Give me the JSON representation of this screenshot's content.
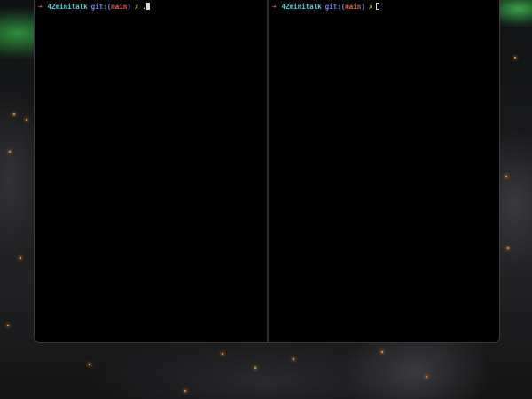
{
  "terminal": {
    "panes": [
      {
        "prompt_arrow": "➜",
        "directory": "42minitalk",
        "git_label": "git:",
        "paren_open": "(",
        "branch": "main",
        "paren_close": ")",
        "dirty_marker": "✗",
        "typed_text": "."
      },
      {
        "prompt_arrow": "➜",
        "directory": "42minitalk",
        "git_label": "git:",
        "paren_open": "(",
        "branch": "main",
        "paren_close": ")",
        "dirty_marker": "✗",
        "typed_text": ""
      }
    ]
  },
  "colors": {
    "terminal_bg": "#000000",
    "prompt_arrow": "#e05a50",
    "directory": "#4fd1d9",
    "git": "#6a7cf0",
    "branch": "#e05a50",
    "dirty": "#e0c060",
    "city_lights": "#f2a23a",
    "aurora": "#3cd250"
  }
}
